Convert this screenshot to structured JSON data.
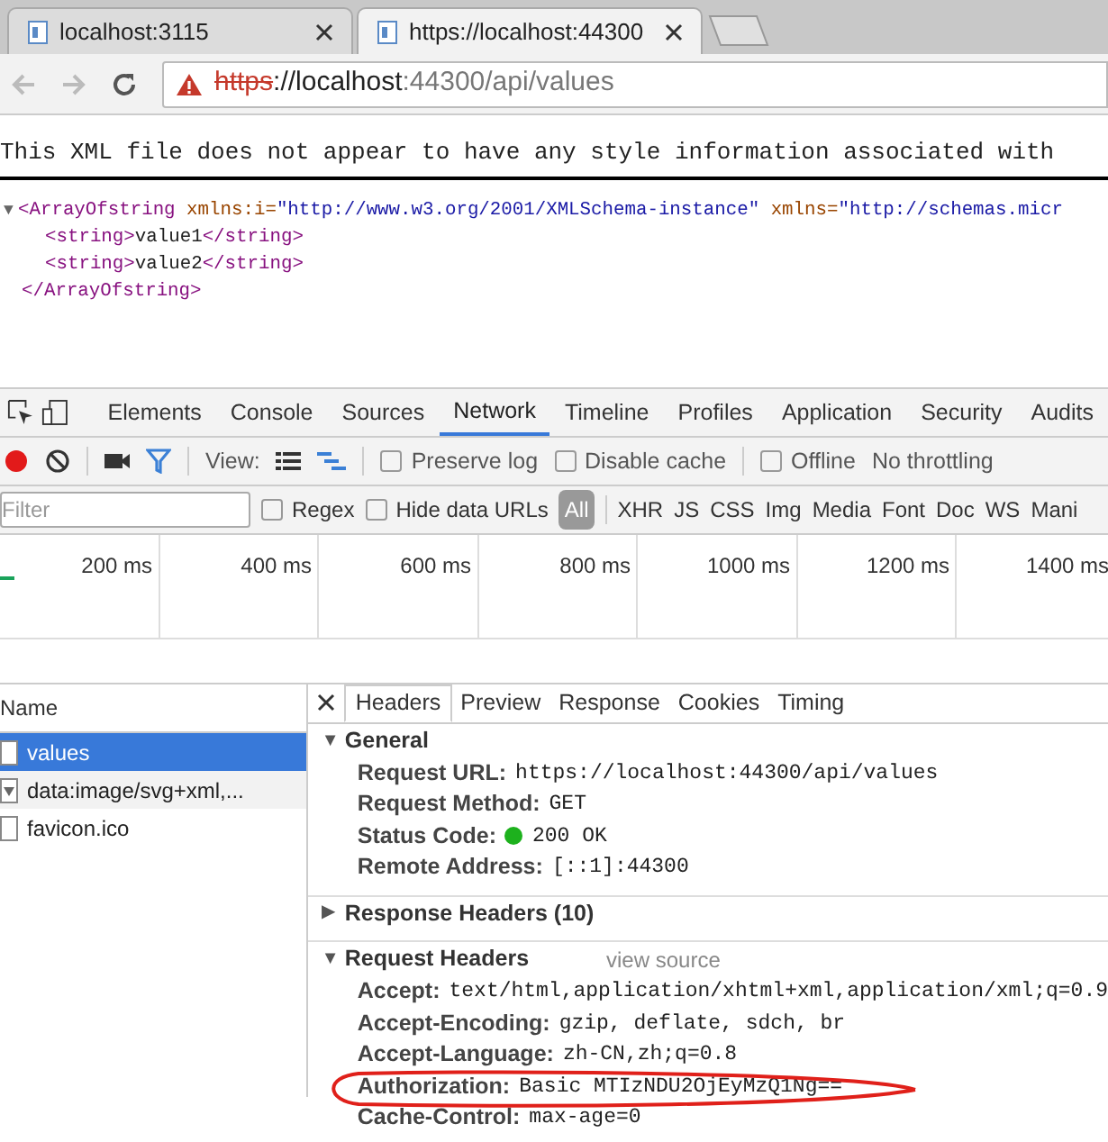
{
  "browser_tabs": [
    {
      "title": "localhost:3115",
      "selected": false
    },
    {
      "title": "https://localhost:44300",
      "selected": true
    }
  ],
  "address_bar": {
    "scheme": "https",
    "rest": "://localhost",
    "path": ":44300/api/values"
  },
  "xml_page": {
    "notice": "This XML file does not appear to have any style information associated with",
    "toggle": "▼",
    "open_tag": "<ArrayOfstring",
    "attr1_name": "xmlns:i=",
    "attr1_value": "\"http://www.w3.org/2001/XMLSchema-instance\"",
    "attr2_name": "xmlns=",
    "attr2_value": "\"http://schemas.micr",
    "items": [
      {
        "open": "<string>",
        "value": "value1",
        "close": "</string>"
      },
      {
        "open": "<string>",
        "value": "value2",
        "close": "</string>"
      }
    ],
    "close_tag": "</ArrayOfstring>"
  },
  "devtools_tabs": [
    {
      "label": "Elements",
      "selected": false
    },
    {
      "label": "Console",
      "selected": false
    },
    {
      "label": "Sources",
      "selected": false
    },
    {
      "label": "Network",
      "selected": true
    },
    {
      "label": "Timeline",
      "selected": false
    },
    {
      "label": "Profiles",
      "selected": false
    },
    {
      "label": "Application",
      "selected": false
    },
    {
      "label": "Security",
      "selected": false
    },
    {
      "label": "Audits",
      "selected": false
    }
  ],
  "toolbar": {
    "view_label": "View:",
    "options": [
      {
        "label": "Preserve log",
        "checked": false
      },
      {
        "label": "Disable cache",
        "checked": false
      },
      {
        "label": "Offline",
        "checked": false
      }
    ],
    "throttling": "No throttling"
  },
  "filter_bar": {
    "placeholder": "Filter",
    "options": [
      {
        "label": "Regex",
        "checked": false
      },
      {
        "label": "Hide data URLs",
        "checked": false
      }
    ],
    "types": [
      {
        "label": "All",
        "selected": true
      },
      {
        "label": "XHR",
        "selected": false
      },
      {
        "label": "JS",
        "selected": false
      },
      {
        "label": "CSS",
        "selected": false
      },
      {
        "label": "Img",
        "selected": false
      },
      {
        "label": "Media",
        "selected": false
      },
      {
        "label": "Font",
        "selected": false
      },
      {
        "label": "Doc",
        "selected": false
      },
      {
        "label": "WS",
        "selected": false
      },
      {
        "label": "Mani",
        "selected": false
      }
    ]
  },
  "timeline_ticks": [
    "200 ms",
    "400 ms",
    "600 ms",
    "800 ms",
    "1000 ms",
    "1200 ms",
    "1400 ms"
  ],
  "requests": {
    "header": "Name",
    "rows": [
      {
        "name": "values",
        "kind": "doc",
        "selected": true
      },
      {
        "name": "data:image/svg+xml,...",
        "kind": "image",
        "selected": false
      },
      {
        "name": "favicon.ico",
        "kind": "doc",
        "selected": false
      }
    ]
  },
  "detail_tabs": [
    {
      "label": "Headers",
      "selected": true
    },
    {
      "label": "Preview",
      "selected": false
    },
    {
      "label": "Response",
      "selected": false
    },
    {
      "label": "Cookies",
      "selected": false
    },
    {
      "label": "Timing",
      "selected": false
    }
  ],
  "sections": [
    {
      "title": "General",
      "toggle": "▼",
      "expanded": true,
      "rows": [
        {
          "key": "Request URL:",
          "value": "https://localhost:44300/api/values"
        },
        {
          "key": "Request Method:",
          "value": "GET"
        },
        {
          "key": "Status Code:",
          "value": "200 OK",
          "ok": true
        },
        {
          "key": "Remote Address:",
          "value": "[::1]:44300"
        }
      ]
    },
    {
      "title": "Response Headers (10)",
      "toggle": "▶",
      "expanded": false
    },
    {
      "title": "Request Headers",
      "toggle": "▼",
      "link": "view source",
      "expanded": true,
      "rows": [
        {
          "key": "Accept:",
          "value": "text/html,application/xhtml+xml,application/xml;q=0.9"
        },
        {
          "key": "Accept-Encoding:",
          "value": "gzip, deflate, sdch, br"
        },
        {
          "key": "Accept-Language:",
          "value": "zh-CN,zh;q=0.8"
        },
        {
          "key": "Authorization:",
          "value": "Basic MTIzNDU2OjEyMzQ1Ng==",
          "circled": true
        },
        {
          "key": "Cache-Control:",
          "value": "max-age=0"
        }
      ]
    }
  ]
}
